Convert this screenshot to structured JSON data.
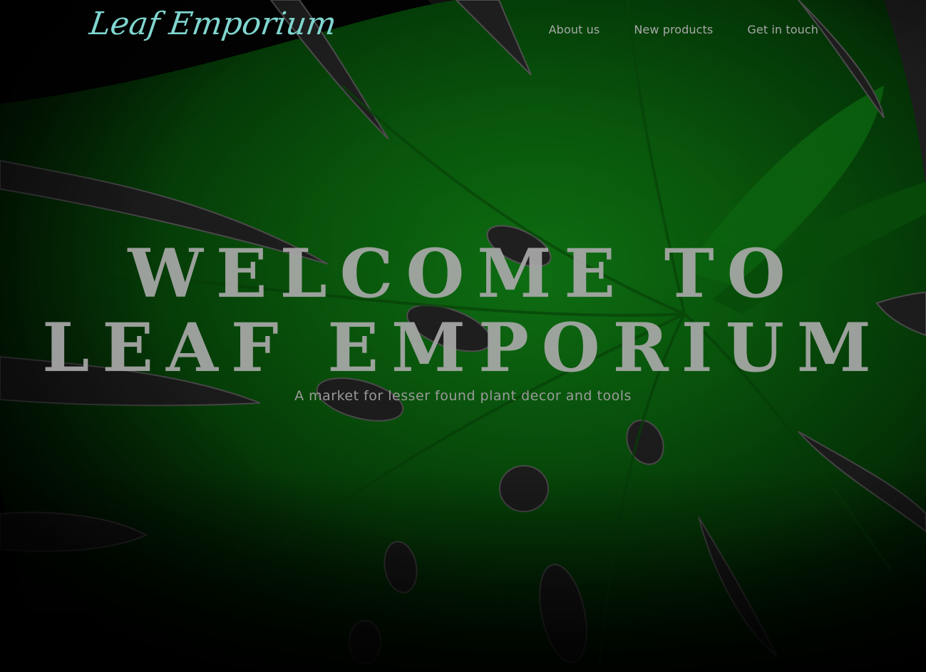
{
  "header": {
    "brand": "Leaf Emporium",
    "nav": [
      {
        "label": "About us"
      },
      {
        "label": "New products"
      },
      {
        "label": "Get in touch"
      }
    ]
  },
  "hero": {
    "title_line1": "WELCOME TO",
    "title_line2": "LEAF EMPORIUM",
    "subtitle": "A market for lesser found plant decor and tools",
    "background_icon": "monstera-leaf-photo-icon"
  },
  "colors": {
    "brand": "#7fd6cf",
    "leaf_green": "#0d7a12",
    "leaf_dark": "#043d07",
    "background": "#020302",
    "title_text": "#a9a9a9",
    "nav_text": "#a8a8a8"
  }
}
